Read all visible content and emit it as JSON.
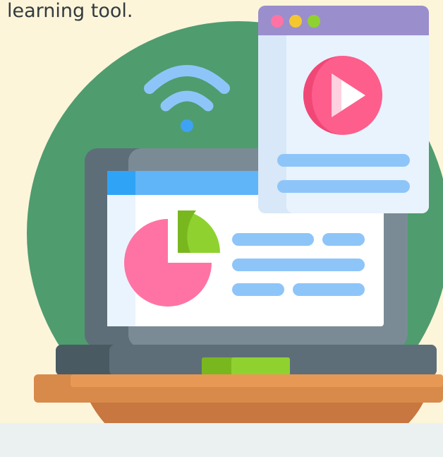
{
  "caption": {
    "text": "learning tool."
  },
  "colors": {
    "background": "#fdf5da",
    "circle": "#4f9c6f",
    "wifi": "#8ec5f9",
    "wifi_dot": "#3ea3f4",
    "laptop_body": "#5e6e79",
    "laptop_frame": "#7b8b96",
    "screen_bg": "#ffffff",
    "screen_header": "#60b5f8",
    "pie_pink": "#ff73a4",
    "pie_green": "#8fd230",
    "text_line": "#8ec5f9",
    "video_header": "#9b8ecc",
    "video_bg": "#e8f3fe",
    "play_button": "#fd5e8b",
    "desk_top": "#e89855",
    "desk_bottom": "#c7773f",
    "trackpad": "#8fd230",
    "window_dot_pink": "#fe73a4",
    "window_dot_yellow": "#f4c730",
    "window_dot_green": "#8fd230"
  },
  "icons": {
    "wifi": "wifi-icon",
    "pie_chart": "pie-chart-icon",
    "play": "play-icon"
  }
}
